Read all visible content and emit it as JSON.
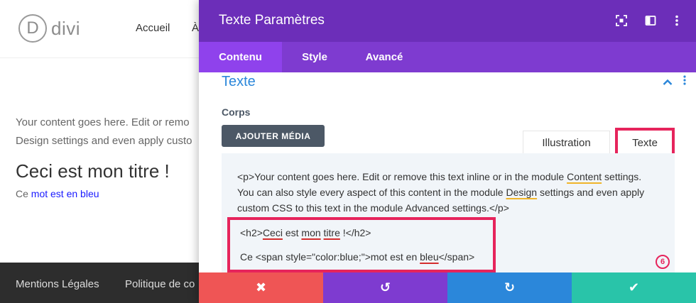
{
  "site": {
    "logo_letter": "D",
    "logo_text": "divi",
    "nav": [
      "Accueil",
      "À"
    ],
    "paragraph_line1": "Your content goes here. Edit or remo",
    "paragraph_line2": "Design settings and even apply custo",
    "heading": "Ceci est mon titre !",
    "small_prefix": "Ce ",
    "small_blue": "mot est en bleu",
    "blue_color": "#1a1aff",
    "footer_links": [
      "Mentions Légales",
      "Politique de co"
    ]
  },
  "modal": {
    "title": "Texte Paramètres",
    "header_icons": [
      "focus-icon",
      "sidebar-layout-icon",
      "more-vertical-icon"
    ],
    "tabs": [
      {
        "label": "Contenu",
        "active": true
      },
      {
        "label": "Style",
        "active": false
      },
      {
        "label": "Avancé",
        "active": false
      }
    ],
    "section_title": "Texte",
    "field_label": "Corps",
    "add_media_label": "AJOUTER MÉDIA",
    "editor_tabs": [
      {
        "label": "Illustration",
        "active": false
      },
      {
        "label": "Texte",
        "active": true
      }
    ],
    "code": {
      "p1_a": "<p>Your content goes here. Edit or remove this text inline or in the module ",
      "p1_content": "Content",
      "p1_b": " settings. You can also style every aspect of this content in the module ",
      "p1_design": "Design",
      "p1_c": " settings and even apply custom CSS to this text in the module Advanced settings.</p>",
      "h2_open": "<h2>",
      "h2_ceci": "Ceci",
      "h2_est": " est ",
      "h2_mon": "mon",
      "h2_space": " ",
      "h2_titre": "titre",
      "h2_close": " !</h2>",
      "span_a": "Ce <span style=\"color:blue;\">mot est en ",
      "span_bleu": "bleu",
      "span_close": "</span>"
    },
    "step_number": "6",
    "actions": [
      {
        "name": "cancel",
        "symbol": "✖",
        "color": "#ef5555"
      },
      {
        "name": "undo",
        "symbol": "↺",
        "color": "#7e3bd0"
      },
      {
        "name": "redo",
        "symbol": "↻",
        "color": "#2b87da"
      },
      {
        "name": "save",
        "symbol": "✔",
        "color": "#29c4a9"
      }
    ],
    "colors": {
      "header": "#6c2eb9",
      "tabs": "#7e3bd0",
      "active_tab": "#8f42ec",
      "highlight": "#e6245c",
      "section_title": "#2b87da"
    }
  }
}
